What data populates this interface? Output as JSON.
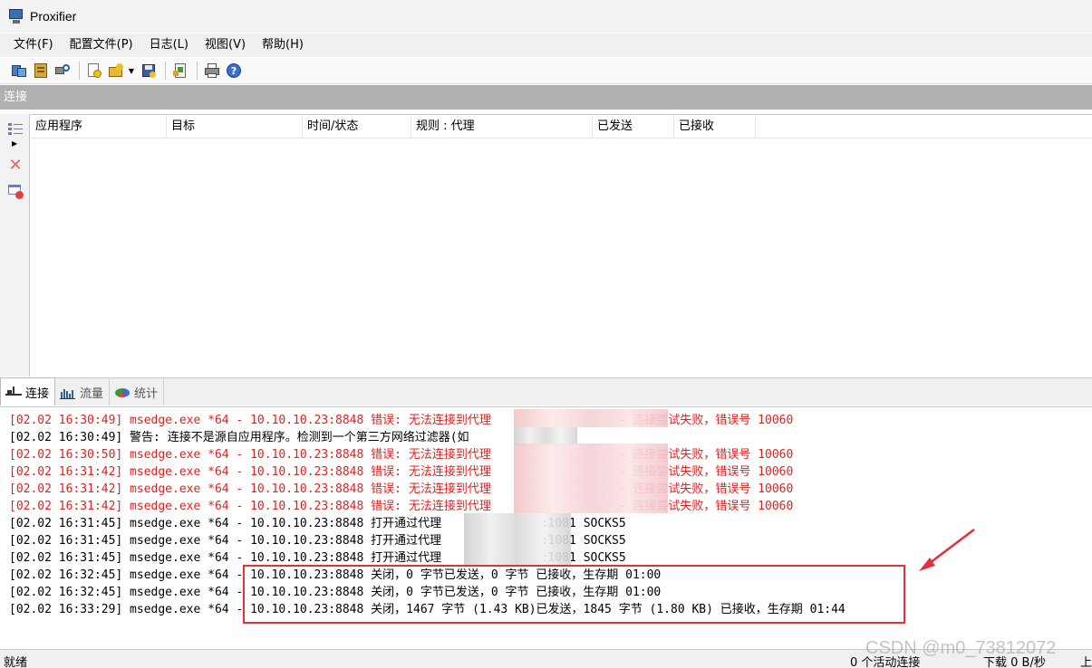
{
  "window": {
    "title": "Proxifier"
  },
  "menu": [
    "文件(F)",
    "配置文件(P)",
    "日志(L)",
    "视图(V)",
    "帮助(H)"
  ],
  "toolbar_icons": [
    "proxy-servers-icon",
    "proxification-rules-icon",
    "name-resolution-icon",
    "new-profile-icon",
    "open-profile-icon",
    "save-profile-icon",
    "advanced-icon",
    "print-icon",
    "help-icon"
  ],
  "panel": {
    "title": "连接"
  },
  "columns": [
    "应用程序",
    "目标",
    "时间/状态",
    "规则 : 代理",
    "已发送",
    "已接收"
  ],
  "tabs": [
    "连接",
    "流量",
    "统计"
  ],
  "log": [
    {
      "text": "[02.02 16:30:49] msedge.exe *64 - 10.10.10.23:8848 错误: 无法连接到代理                  - 连接尝试失败，错误号 10060",
      "type": "error"
    },
    {
      "text": "[02.02 16:30:49] 警告: 连接不是源自应用程序。检测到一个第三方网络过滤器(如",
      "type": "normal"
    },
    {
      "text": "[02.02 16:30:50] msedge.exe *64 - 10.10.10.23:8848 错误: 无法连接到代理                  - 连接尝试失败，错误号 10060",
      "type": "error"
    },
    {
      "text": "[02.02 16:31:42] msedge.exe *64 - 10.10.10.23:8848 错误: 无法连接到代理                  - 连接尝试失败，错误号 10060",
      "type": "error"
    },
    {
      "text": "[02.02 16:31:42] msedge.exe *64 - 10.10.10.23:8848 错误: 无法连接到代理                  - 连接尝试失败，错误号 10060",
      "type": "error"
    },
    {
      "text": "[02.02 16:31:42] msedge.exe *64 - 10.10.10.23:8848 错误: 无法连接到代理                  - 连接尝试失败，错误号 10060",
      "type": "error"
    },
    {
      "text": "[02.02 16:31:45] msedge.exe *64 - 10.10.10.23:8848 打开通过代理              :1081 SOCKS5",
      "type": "normal"
    },
    {
      "text": "[02.02 16:31:45] msedge.exe *64 - 10.10.10.23:8848 打开通过代理              :1081 SOCKS5",
      "type": "normal"
    },
    {
      "text": "[02.02 16:31:45] msedge.exe *64 - 10.10.10.23:8848 打开通过代理              :1081 SOCKS5",
      "type": "normal"
    },
    {
      "text": "[02.02 16:32:45] msedge.exe *64 - 10.10.10.23:8848 关闭，0 字节已发送，0 字节 已接收，生存期 01:00",
      "type": "normal"
    },
    {
      "text": "[02.02 16:32:45] msedge.exe *64 - 10.10.10.23:8848 关闭，0 字节已发送，0 字节 已接收，生存期 01:00",
      "type": "normal"
    },
    {
      "text": "[02.02 16:33:29] msedge.exe *64 - 10.10.10.23:8848 关闭，1467 字节 (1.43 KB)已发送，1845 字节 (1.80 KB) 已接收，生存期 01:44",
      "type": "normal"
    }
  ],
  "status": {
    "ready": "就绪",
    "active_connections": "0 个活动连接",
    "download": "下载 0 B/秒",
    "upload": "上"
  },
  "watermark": "CSDN @m0_73812072",
  "colors": {
    "error": "#e02020",
    "highlight": "#e0303a",
    "panel_header": "#b0b0b0"
  }
}
